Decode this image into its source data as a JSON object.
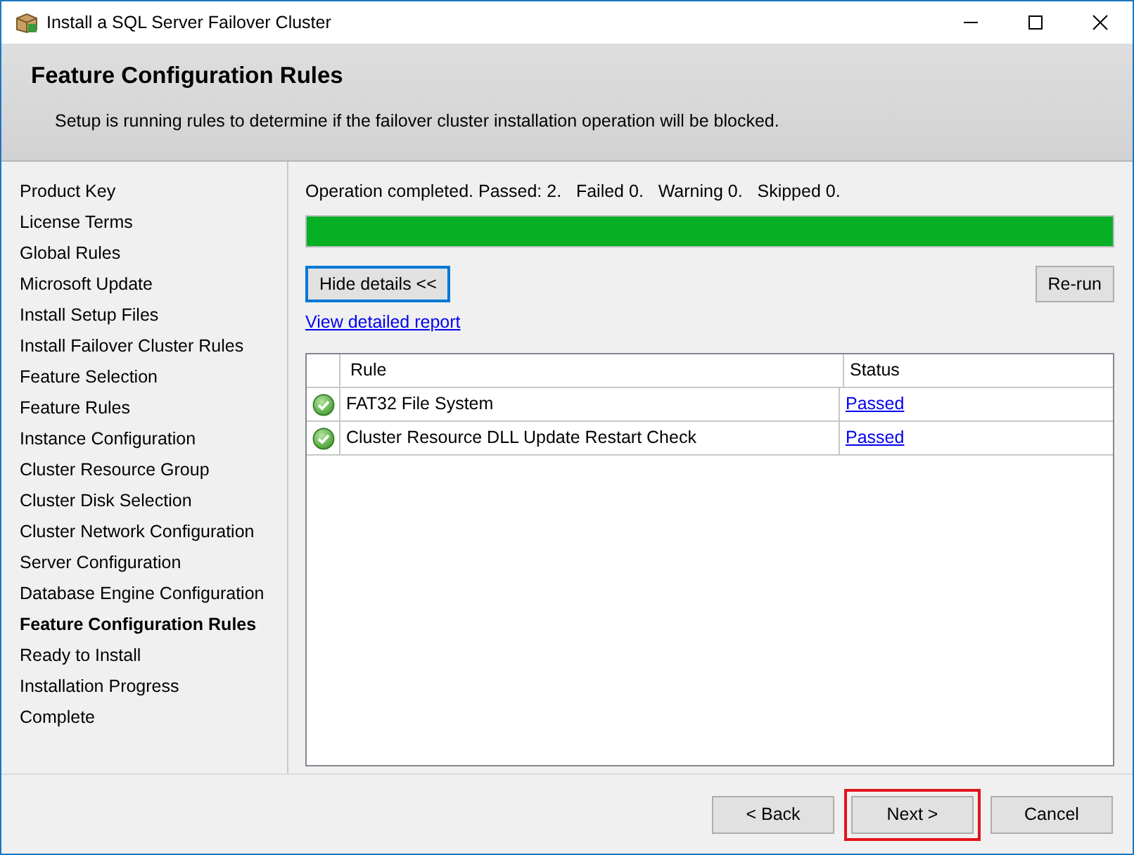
{
  "window": {
    "title": "Install a SQL Server Failover Cluster"
  },
  "header": {
    "title": "Feature Configuration Rules",
    "subtitle": "Setup is running rules to determine if the failover cluster installation operation will be blocked."
  },
  "sidebar": {
    "items": [
      {
        "label": "Product Key",
        "selected": false
      },
      {
        "label": "License Terms",
        "selected": false
      },
      {
        "label": "Global Rules",
        "selected": false
      },
      {
        "label": "Microsoft Update",
        "selected": false
      },
      {
        "label": "Install Setup Files",
        "selected": false
      },
      {
        "label": "Install Failover Cluster Rules",
        "selected": false
      },
      {
        "label": "Feature Selection",
        "selected": false
      },
      {
        "label": "Feature Rules",
        "selected": false
      },
      {
        "label": "Instance Configuration",
        "selected": false
      },
      {
        "label": "Cluster Resource Group",
        "selected": false
      },
      {
        "label": "Cluster Disk Selection",
        "selected": false
      },
      {
        "label": "Cluster Network Configuration",
        "selected": false
      },
      {
        "label": "Server Configuration",
        "selected": false
      },
      {
        "label": "Database Engine Configuration",
        "selected": false
      },
      {
        "label": "Feature Configuration Rules",
        "selected": true
      },
      {
        "label": "Ready to Install",
        "selected": false
      },
      {
        "label": "Installation Progress",
        "selected": false
      },
      {
        "label": "Complete",
        "selected": false
      }
    ]
  },
  "status_text": "Operation completed. Passed: 2.   Failed 0.   Warning 0.   Skipped 0.",
  "progress": {
    "level": 1
  },
  "hide_details_button": "Hide details <<",
  "rerun_button": "Re-run",
  "report_link": "View detailed report",
  "table": {
    "columns": [
      "Rule",
      "Status"
    ],
    "rows": [
      {
        "rule": "FAT32 File System",
        "status": "Passed",
        "kind": "passed"
      },
      {
        "rule": "Cluster Resource DLL Update Restart Check",
        "status": "Passed",
        "kind": "passed"
      }
    ]
  },
  "buttons": [
    {
      "label": "< Back",
      "highlighted": false
    },
    {
      "label": "Next >",
      "highlighted": true
    },
    {
      "label": "Cancel",
      "highlighted": false
    }
  ]
}
